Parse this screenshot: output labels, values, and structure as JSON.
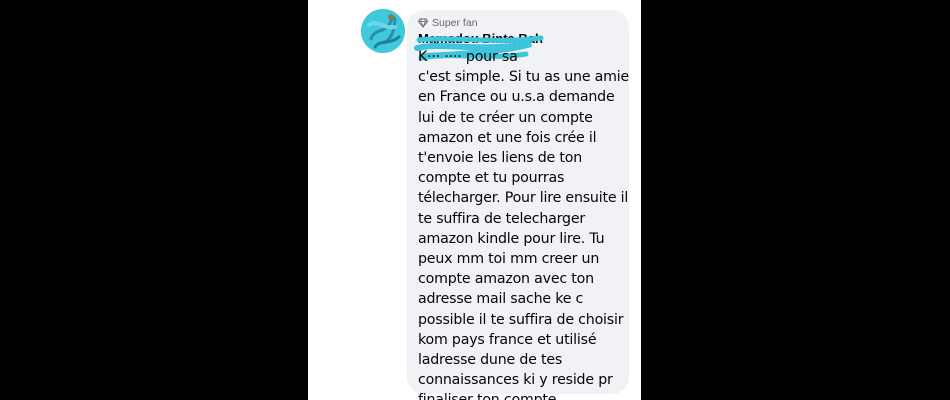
{
  "comment": {
    "badge_label": "Super fan",
    "badge_icon": "diamond-icon",
    "author_name": "Mamadou Binta Bah",
    "text": "K··· ···· pour sa\nc'est simple. Si tu as une amie\nen France ou u.s.a demande\nlui de te créer un compte\namazon et une fois crée il\nt'envoie les liens de ton\ncompte et tu pourras\ntélecharger. Pour lire ensuite il\nte suffira de telecharger\namazon kindle pour lire. Tu\npeux mm toi mm creer un\ncompte amazon avec ton\nadresse mail sache ke c\npossible il te suffira de choisir\nkom pays france et utilisé\nladresse dune de tes\nconnaissances ki y reside pr\nfinaliser ton compte"
  },
  "colors": {
    "background": "#000000",
    "panel": "#ffffff",
    "bubble": "#f0f2f5",
    "text": "#050505",
    "secondary_text": "#65676b",
    "redaction": "#3fc4dd"
  }
}
